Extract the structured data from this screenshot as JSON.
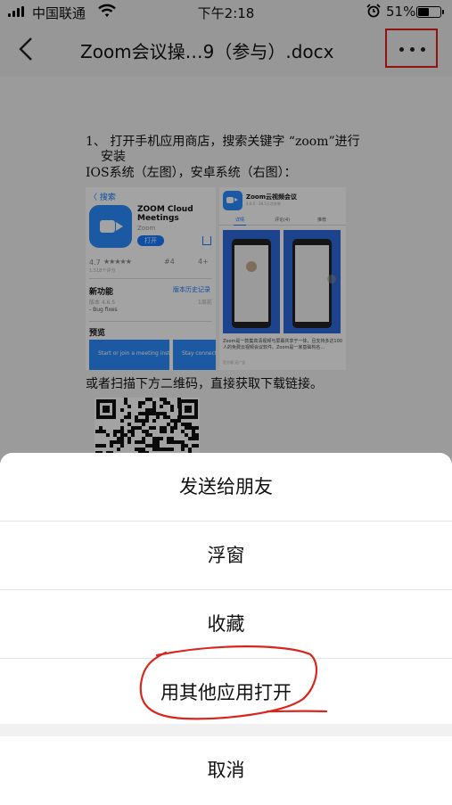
{
  "status_bar": {
    "carrier": "中国联通",
    "time": "下午2:18",
    "battery_percent": "51%",
    "battery_level": 0.51,
    "icons": [
      "signal-icon",
      "wifi-icon",
      "alarm-icon",
      "battery-icon"
    ]
  },
  "nav": {
    "title": "Zoom会议操…9（参与）.docx",
    "back_icon": "chevron-left-icon",
    "more_icon": "more-dots-icon",
    "highlight_color": "#e0201a"
  },
  "document": {
    "line1": "1、 打开手机应用商店，搜索关键字 “zoom”进行",
    "line1_cont": "安装",
    "line2": "IOS系统（左图），安卓系统（右图）：",
    "ios_screenshot": {
      "back": "〈 搜索",
      "app_name": "ZOOM Cloud Meetings",
      "developer": "Zoom",
      "get_button": "打开",
      "rating": "4.7",
      "stars": "★★★★★",
      "ratings_count": "1,518个评分",
      "rank": "#4",
      "age": "4+",
      "whats_new": "新功能",
      "version_history": "版本历史记录",
      "version": "版本 4.6.5",
      "updated": "1周前",
      "fix": "- Bug fixes",
      "preview": "预览",
      "tile1": "Start or join a meeting instantly",
      "tile2": "Stay connected with instant messaging"
    },
    "android_screenshot": {
      "app_name": "Zoom云视频会议",
      "meta": "4.6.0 · 28.5万次安装",
      "tabs": [
        "详情",
        "评论(4)",
        "推荐"
      ],
      "description": "Zoom是一款集高清视频与屏幕共享于一体，且支持多达100人的免费云视频会议软件。Zoom是一家基础构名...",
      "footer": "官方版  无广告"
    },
    "line3": "或者扫描下方二维码，直接获取下载链接。",
    "accent_color": "#2d8cff"
  },
  "sheet": {
    "items": [
      "发送给朋友",
      "浮窗",
      "收藏",
      "用其他应用打开"
    ],
    "cancel": "取消",
    "annotation_color": "#d9261c"
  }
}
